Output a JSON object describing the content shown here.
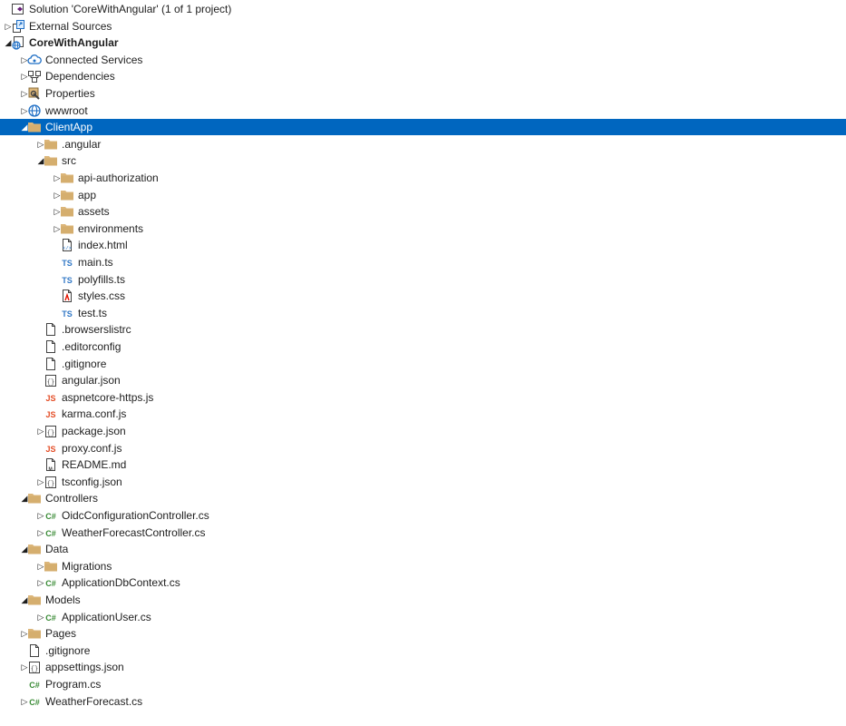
{
  "colors": {
    "selection": "#0066bf",
    "folder": "#dcb67a",
    "folder_dark": "#c9a05a",
    "typescript": "#3178c6",
    "javascript": "#e44d26",
    "csharp": "#388a34",
    "globe": "#1f6fc5",
    "text": "#1e1e1e"
  },
  "tree": [
    {
      "depth": 0,
      "arrow": "none",
      "icon": "solution-icon",
      "label": "Solution 'CoreWithAngular' (1 of 1 project)"
    },
    {
      "depth": 0,
      "arrow": "collapsed",
      "icon": "external-sources-icon",
      "label": "External Sources"
    },
    {
      "depth": 0,
      "arrow": "expanded",
      "icon": "project-icon",
      "label": "CoreWithAngular",
      "bold": true
    },
    {
      "depth": 1,
      "arrow": "collapsed",
      "icon": "connected-services-icon",
      "label": "Connected Services"
    },
    {
      "depth": 1,
      "arrow": "collapsed",
      "icon": "dependencies-icon",
      "label": "Dependencies"
    },
    {
      "depth": 1,
      "arrow": "collapsed",
      "icon": "properties-icon",
      "label": "Properties"
    },
    {
      "depth": 1,
      "arrow": "collapsed",
      "icon": "globe-icon",
      "label": "wwwroot"
    },
    {
      "depth": 1,
      "arrow": "expanded",
      "icon": "folder-icon",
      "label": "ClientApp",
      "selected": true
    },
    {
      "depth": 2,
      "arrow": "collapsed",
      "icon": "folder-icon",
      "label": ".angular"
    },
    {
      "depth": 2,
      "arrow": "expanded",
      "icon": "folder-icon",
      "label": "src"
    },
    {
      "depth": 3,
      "arrow": "collapsed",
      "icon": "folder-icon",
      "label": "api-authorization"
    },
    {
      "depth": 3,
      "arrow": "collapsed",
      "icon": "folder-icon",
      "label": "app"
    },
    {
      "depth": 3,
      "arrow": "collapsed",
      "icon": "folder-icon",
      "label": "assets"
    },
    {
      "depth": 3,
      "arrow": "collapsed",
      "icon": "folder-icon",
      "label": "environments"
    },
    {
      "depth": 3,
      "arrow": "none",
      "icon": "html-file-icon",
      "label": "index.html"
    },
    {
      "depth": 3,
      "arrow": "none",
      "icon": "typescript-file-icon",
      "label": "main.ts"
    },
    {
      "depth": 3,
      "arrow": "none",
      "icon": "typescript-file-icon",
      "label": "polyfills.ts"
    },
    {
      "depth": 3,
      "arrow": "none",
      "icon": "css-file-icon",
      "label": "styles.css"
    },
    {
      "depth": 3,
      "arrow": "none",
      "icon": "typescript-file-icon",
      "label": "test.ts"
    },
    {
      "depth": 2,
      "arrow": "none",
      "icon": "file-icon",
      "label": ".browserslistrc"
    },
    {
      "depth": 2,
      "arrow": "none",
      "icon": "file-icon",
      "label": ".editorconfig"
    },
    {
      "depth": 2,
      "arrow": "none",
      "icon": "file-icon",
      "label": ".gitignore"
    },
    {
      "depth": 2,
      "arrow": "none",
      "icon": "json-file-icon",
      "label": "angular.json"
    },
    {
      "depth": 2,
      "arrow": "none",
      "icon": "javascript-file-icon",
      "label": "aspnetcore-https.js"
    },
    {
      "depth": 2,
      "arrow": "none",
      "icon": "javascript-file-icon",
      "label": "karma.conf.js"
    },
    {
      "depth": 2,
      "arrow": "collapsed",
      "icon": "json-file-icon",
      "label": "package.json"
    },
    {
      "depth": 2,
      "arrow": "none",
      "icon": "javascript-file-icon",
      "label": "proxy.conf.js"
    },
    {
      "depth": 2,
      "arrow": "none",
      "icon": "markdown-file-icon",
      "label": "README.md"
    },
    {
      "depth": 2,
      "arrow": "collapsed",
      "icon": "json-file-icon",
      "label": "tsconfig.json"
    },
    {
      "depth": 1,
      "arrow": "expanded",
      "icon": "folder-icon",
      "label": "Controllers"
    },
    {
      "depth": 2,
      "arrow": "collapsed",
      "icon": "csharp-file-icon",
      "label": "OidcConfigurationController.cs"
    },
    {
      "depth": 2,
      "arrow": "collapsed",
      "icon": "csharp-file-icon",
      "label": "WeatherForecastController.cs"
    },
    {
      "depth": 1,
      "arrow": "expanded",
      "icon": "folder-icon",
      "label": "Data"
    },
    {
      "depth": 2,
      "arrow": "collapsed",
      "icon": "folder-icon",
      "label": "Migrations"
    },
    {
      "depth": 2,
      "arrow": "collapsed",
      "icon": "csharp-file-icon",
      "label": "ApplicationDbContext.cs"
    },
    {
      "depth": 1,
      "arrow": "expanded",
      "icon": "folder-icon",
      "label": "Models"
    },
    {
      "depth": 2,
      "arrow": "collapsed",
      "icon": "csharp-file-icon",
      "label": "ApplicationUser.cs"
    },
    {
      "depth": 1,
      "arrow": "collapsed",
      "icon": "folder-icon",
      "label": "Pages"
    },
    {
      "depth": 1,
      "arrow": "none",
      "icon": "file-icon",
      "label": ".gitignore"
    },
    {
      "depth": 1,
      "arrow": "collapsed",
      "icon": "json-file-icon",
      "label": "appsettings.json"
    },
    {
      "depth": 1,
      "arrow": "none",
      "icon": "csharp-file-icon",
      "label": "Program.cs"
    },
    {
      "depth": 1,
      "arrow": "collapsed",
      "icon": "csharp-file-icon",
      "label": "WeatherForecast.cs"
    }
  ]
}
